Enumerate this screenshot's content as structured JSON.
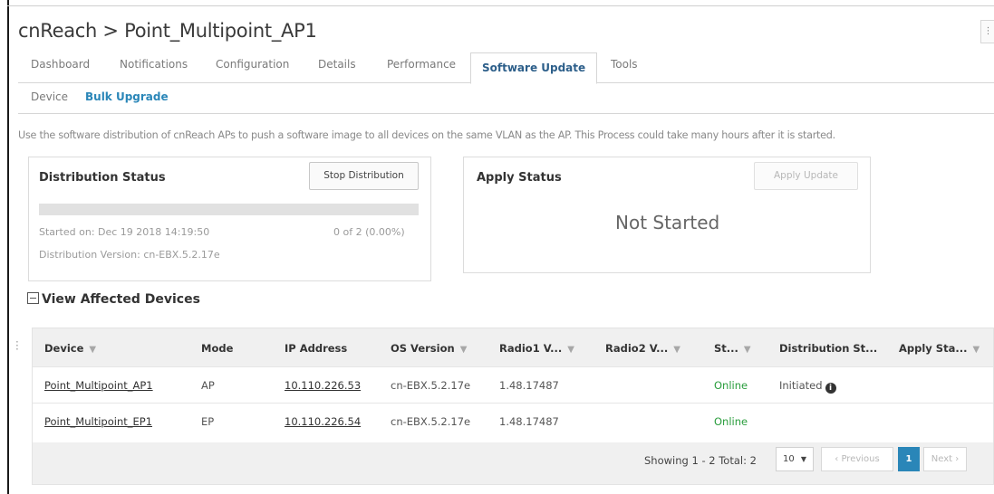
{
  "header": {
    "title": "cnReach > Point_Multipoint_AP1"
  },
  "tabs": [
    {
      "label": "Dashboard"
    },
    {
      "label": "Notifications"
    },
    {
      "label": "Configuration"
    },
    {
      "label": "Details"
    },
    {
      "label": "Performance"
    },
    {
      "label": "Software Update"
    },
    {
      "label": "Tools"
    }
  ],
  "active_tab": "Software Update",
  "subtabs": [
    {
      "label": "Device"
    },
    {
      "label": "Bulk Upgrade"
    }
  ],
  "active_subtab": "Bulk Upgrade",
  "description": "Use the software distribution of cnReach APs to push a software image to all devices on the same VLAN as the AP. This Process could take many hours after it is started.",
  "distribution": {
    "title": "Distribution Status",
    "stop_button": "Stop Distribution",
    "started_on": "Started on: Dec 19 2018 14:19:50",
    "progress_text": "0 of 2 (0.00%)",
    "progress_fraction": 0.0,
    "version": "Distribution Version: cn-EBX.5.2.17e"
  },
  "apply": {
    "title": "Apply Status",
    "apply_button": "Apply Update",
    "status": "Not Started"
  },
  "affected": {
    "toggle_label": "View Affected Devices"
  },
  "table": {
    "columns": [
      "Device",
      "Mode",
      "IP Address",
      "OS Version",
      "Radio1 V...",
      "Radio2 V...",
      "St...",
      "Distribution St...",
      "Apply Sta..."
    ],
    "rows": [
      {
        "device": "Point_Multipoint_AP1",
        "mode": "AP",
        "ip": "10.110.226.53",
        "os": "cn-EBX.5.2.17e",
        "radio1": "1.48.17487",
        "radio2": "",
        "status": "Online",
        "distribution": "Initiated",
        "apply": ""
      },
      {
        "device": "Point_Multipoint_EP1",
        "mode": "EP",
        "ip": "10.110.226.54",
        "os": "cn-EBX.5.2.17e",
        "radio1": "1.48.17487",
        "radio2": "",
        "status": "Online",
        "distribution": "",
        "apply": ""
      }
    ]
  },
  "pagination": {
    "showing": "Showing 1 - 2 Total: 2",
    "per_page": "10",
    "previous": "‹ Previous",
    "current_page": "1",
    "next": "Next ›"
  },
  "icons": {
    "filter": "filter-icon",
    "info": "info-icon",
    "collapse": "collapse-icon",
    "dropdown": "chevron-down-icon"
  },
  "colors": {
    "accent": "#2a86b8",
    "active_tab_text": "#2d5f8a",
    "online": "#2a9d3d"
  }
}
